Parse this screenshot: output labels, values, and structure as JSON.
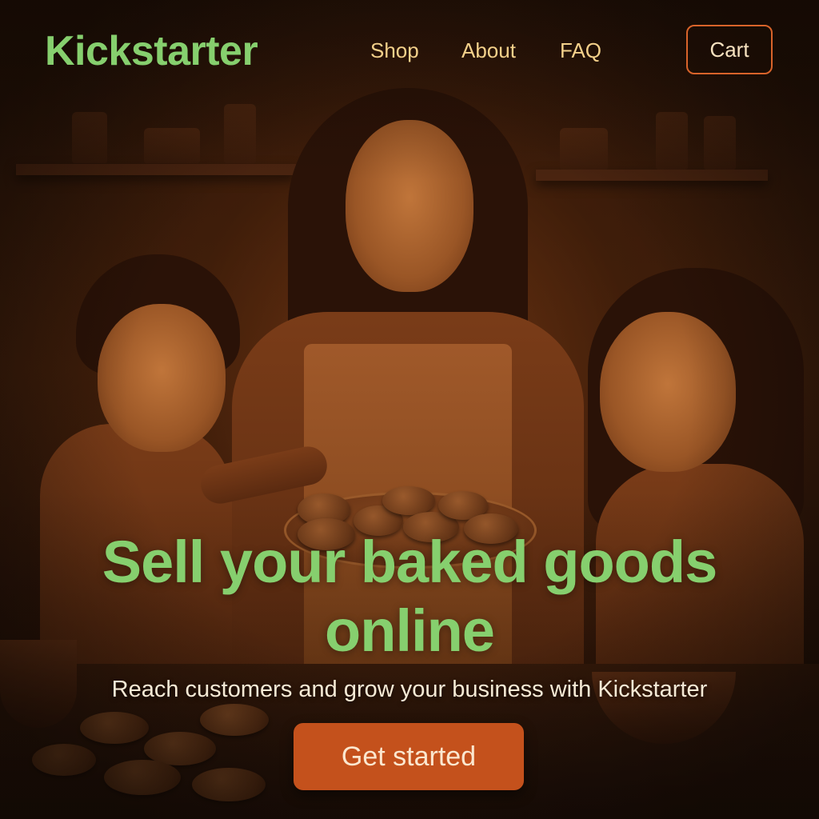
{
  "header": {
    "brand": "Kickstarter",
    "nav": {
      "shop": "Shop",
      "about": "About",
      "faq": "FAQ"
    },
    "cart_label": "Cart"
  },
  "hero": {
    "headline_line1": "Sell your baked goods",
    "headline_line2": "online",
    "subtitle": "Reach customers and grow your business with Kickstarter",
    "cta_label": "Get started"
  },
  "colors": {
    "brand_green": "#86cf6e",
    "nav_text": "#f3d08a",
    "cta_orange": "#c4511c",
    "cart_border": "#d8632a"
  }
}
